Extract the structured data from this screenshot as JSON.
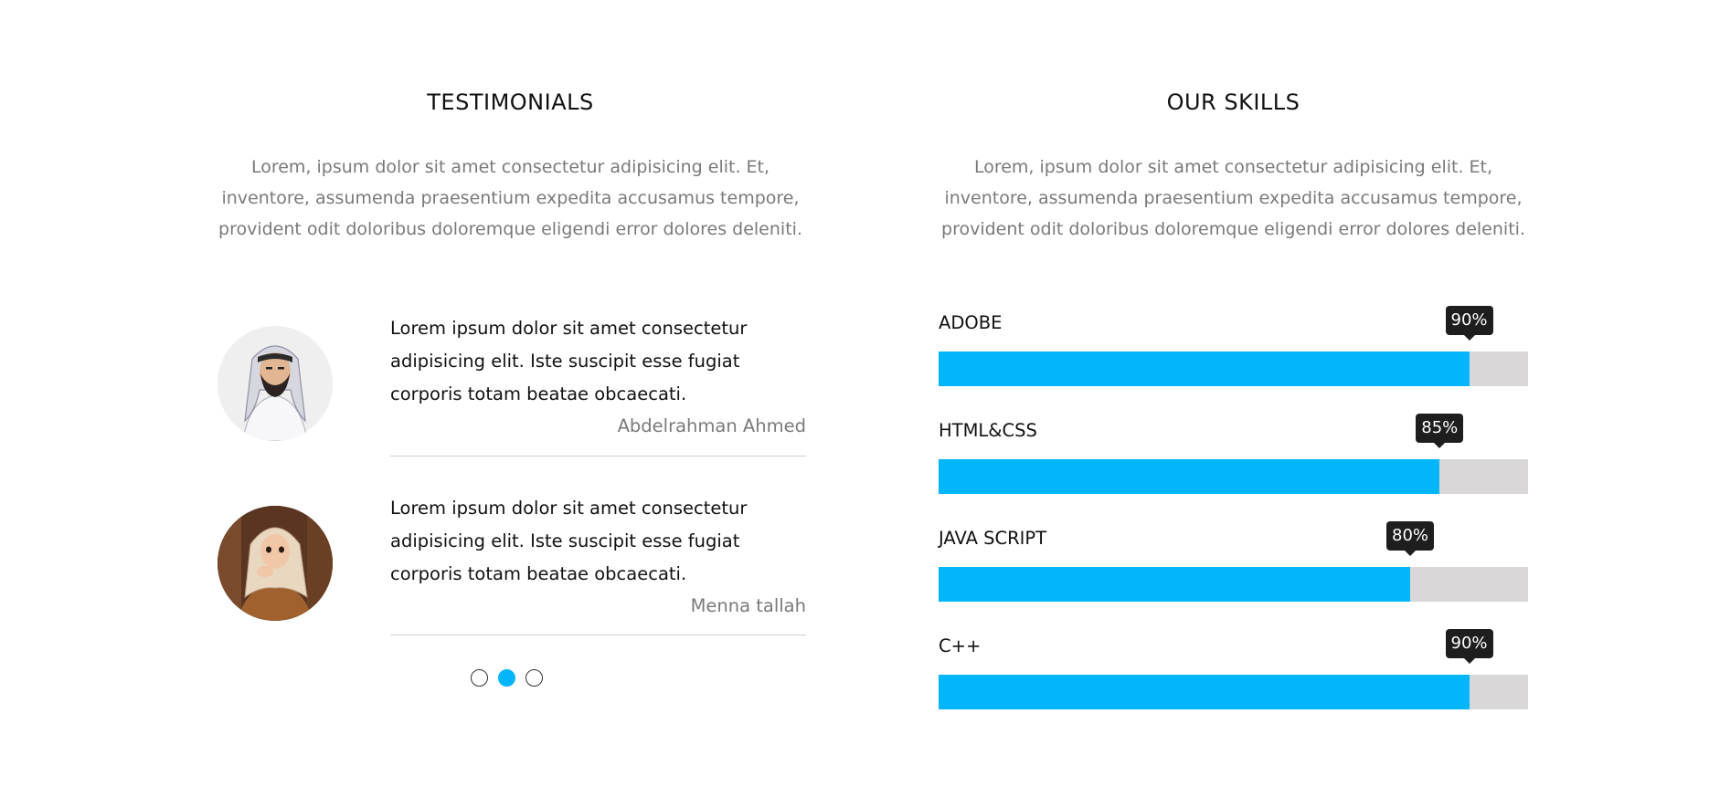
{
  "testimonials": {
    "title": "TESTIMONIALS",
    "intro": "Lorem, ipsum dolor sit amet consectetur adipisicing elit. Et, inventore, assumenda praesentium expedita accusamus tempore, provident odit doloribus doloremque eligendi error dolores deleniti.",
    "items": [
      {
        "text": "Lorem ipsum dolor sit amet consectetur adipisicing elit. Iste suscipit esse fugiat corporis totam beatae obcaecati.",
        "author": "Abdelrahman Ahmed"
      },
      {
        "text": "Lorem ipsum dolor sit amet consectetur adipisicing elit. Iste suscipit esse fugiat corporis totam beatae obcaecati.",
        "author": "Menna tallah"
      }
    ],
    "pagination": {
      "count": 3,
      "active_index": 1
    }
  },
  "skills": {
    "title": "OUR SKILLS",
    "intro": "Lorem, ipsum dolor sit amet consectetur adipisicing elit. Et, inventore, assumenda praesentium expedita accusamus tempore, provident odit doloribus doloremque eligendi error dolores deleniti.",
    "items": [
      {
        "name": "ADOBE",
        "percent": 90,
        "label": "90%"
      },
      {
        "name": "HTML&CSS",
        "percent": 85,
        "label": "85%"
      },
      {
        "name": "JAVA SCRIPT",
        "percent": 80,
        "label": "80%"
      },
      {
        "name": "C++",
        "percent": 90,
        "label": "90%"
      }
    ]
  },
  "colors": {
    "accent": "#03b5fb",
    "track": "#d9d7d8",
    "tooltip": "#1e1e1e",
    "muted_text": "#7a7a7a"
  }
}
